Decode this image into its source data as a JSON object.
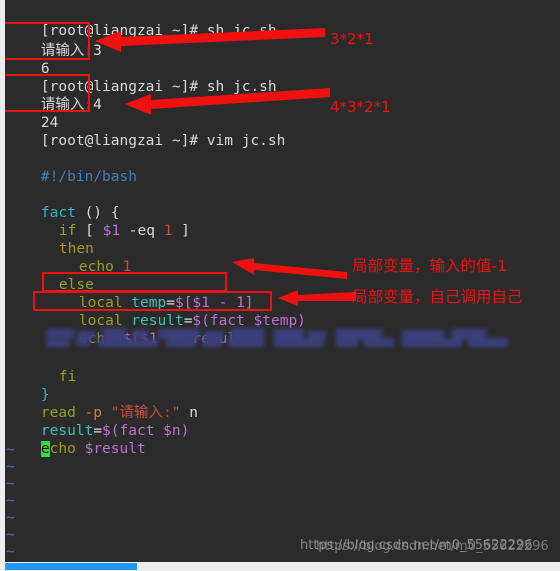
{
  "window": {
    "kind": "terminal-vim-session",
    "background": "#2b2b2b",
    "foreground": "#d9d9d9"
  },
  "terminal": {
    "prompt": "[root@liangzai ~]#",
    "lines": [
      {
        "prompt": "[root@liangzai ~]#",
        "command": " sh jc.sh"
      },
      {
        "output": "请输入:3"
      },
      {
        "output": "6"
      },
      {
        "prompt": "[root@liangzai ~]#",
        "command": " sh jc.sh"
      },
      {
        "output": "请输入:4"
      },
      {
        "output": "24"
      },
      {
        "prompt": "[root@liangzai ~]#",
        "command": " vim jc.sh"
      }
    ]
  },
  "editor": {
    "shebang": "#!/bin/bash",
    "code": {
      "fn_name": "fact",
      "fn_open": " () {",
      "if_kw": "if",
      "if_test": " [ ",
      "if_var": "$1",
      "if_op": " -eq ",
      "if_num": "1",
      "if_close": " ]",
      "then_kw": "then",
      "echo1_kw": "echo",
      "echo1_num": " 1",
      "else_kw": "else",
      "local1_kw": "local",
      "local1_name": " temp",
      "local1_eq": "=",
      "local1_val": "$[$1 - 1]",
      "local2_kw": "local",
      "local2_name": " result",
      "local2_eq": "=",
      "local2_val": "$(fact $temp)",
      "echo2_kw": "echo",
      "echo2_val": " $[$1 * $result]",
      "fi_kw": "fi",
      "brace_close": "}",
      "read_kw": "read",
      "read_flag": " -p ",
      "read_str": "\"请输入:\"",
      "read_var": " n",
      "res_name": "result",
      "res_eq": "=",
      "res_val": "$(fact $n)",
      "echo3_cursor": "e",
      "echo3_kw": "cho",
      "echo3_val": " $result"
    },
    "empty_marker": "~",
    "empty_marker_count": 8,
    "cursor_color": "#33e033"
  },
  "annotations": {
    "accent": "#f01010",
    "items": [
      {
        "name": "note-3-factorial",
        "text": "3*2*1"
      },
      {
        "name": "note-4-factorial",
        "text": "4*3*2*1"
      },
      {
        "name": "note-local-temp",
        "text": "局部变量，输入的值-1"
      },
      {
        "name": "note-local-result",
        "text": "局部变量，自己调用自己"
      }
    ]
  },
  "watermark": {
    "text": "https://blog.csdn.net/m0_55622296"
  }
}
